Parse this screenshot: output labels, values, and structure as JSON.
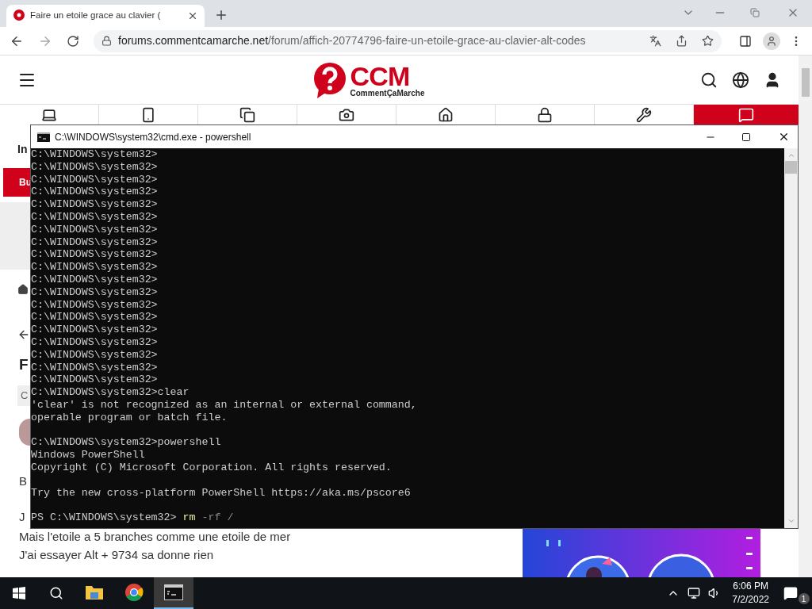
{
  "browser": {
    "tab": {
      "title": "Faire un etoile grace au clavier (",
      "selected": true
    },
    "url": {
      "host": "forums.commentcamarche.net",
      "path": "/forum/affich-20774796-faire-un-etoile-grace-au-clavier-alt-codes"
    }
  },
  "site": {
    "logo": {
      "mark": "CCM",
      "tagline": "CommentÇaMarche"
    },
    "fragments": [
      {
        "kind": "label",
        "text": "In"
      },
      {
        "kind": "button",
        "text": "Bu"
      },
      {
        "kind": "heading",
        "text": "F"
      },
      {
        "kind": "tag",
        "text": "C"
      },
      {
        "kind": "para",
        "text": "B"
      },
      {
        "kind": "para",
        "text": "J"
      }
    ],
    "post_lines": [
      "Mais l'etoile a 5 branches comme une etoile de mer",
      "J'ai essayer Alt + 9734 sa donne rien"
    ]
  },
  "console": {
    "title": "C:\\WINDOWS\\system32\\cmd.exe - powershell",
    "lines": [
      {
        "kind": "text",
        "text": "C:\\WINDOWS\\system32>"
      },
      {
        "kind": "text",
        "text": "C:\\WINDOWS\\system32>"
      },
      {
        "kind": "text",
        "text": "C:\\WINDOWS\\system32>"
      },
      {
        "kind": "text",
        "text": "C:\\WINDOWS\\system32>"
      },
      {
        "kind": "text",
        "text": "C:\\WINDOWS\\system32>"
      },
      {
        "kind": "text",
        "text": "C:\\WINDOWS\\system32>"
      },
      {
        "kind": "text",
        "text": "C:\\WINDOWS\\system32>"
      },
      {
        "kind": "text",
        "text": "C:\\WINDOWS\\system32>"
      },
      {
        "kind": "text",
        "text": "C:\\WINDOWS\\system32>"
      },
      {
        "kind": "text",
        "text": "C:\\WINDOWS\\system32>"
      },
      {
        "kind": "text",
        "text": "C:\\WINDOWS\\system32>"
      },
      {
        "kind": "text",
        "text": "C:\\WINDOWS\\system32>"
      },
      {
        "kind": "text",
        "text": "C:\\WINDOWS\\system32>"
      },
      {
        "kind": "text",
        "text": "C:\\WINDOWS\\system32>"
      },
      {
        "kind": "text",
        "text": "C:\\WINDOWS\\system32>"
      },
      {
        "kind": "text",
        "text": "C:\\WINDOWS\\system32>"
      },
      {
        "kind": "text",
        "text": "C:\\WINDOWS\\system32>"
      },
      {
        "kind": "text",
        "text": "C:\\WINDOWS\\system32>"
      },
      {
        "kind": "text",
        "text": "C:\\WINDOWS\\system32>"
      },
      {
        "kind": "text",
        "text": "C:\\WINDOWS\\system32>clear"
      },
      {
        "kind": "text",
        "text": "'clear' is not recognized as an internal or external command,"
      },
      {
        "kind": "text",
        "text": "operable program or batch file."
      },
      {
        "kind": "blank"
      },
      {
        "kind": "text",
        "text": "C:\\WINDOWS\\system32>powershell"
      },
      {
        "kind": "text",
        "text": "Windows PowerShell"
      },
      {
        "kind": "text",
        "text": "Copyright (C) Microsoft Corporation. All rights reserved."
      },
      {
        "kind": "blank"
      },
      {
        "kind": "text",
        "text": "Try the new cross-platform PowerShell https://aka.ms/pscore6"
      },
      {
        "kind": "blank"
      },
      {
        "kind": "input",
        "prompt": "PS C:\\WINDOWS\\system32>",
        "command": "rm",
        "args": "-rf /"
      }
    ]
  },
  "taskbar": {
    "apps": [
      {
        "kind": "folder",
        "selected": false
      },
      {
        "kind": "chrome",
        "selected": false
      },
      {
        "kind": "terminal",
        "selected": true
      }
    ],
    "time": "6:06 PM",
    "date": "7/2/2022",
    "notifications": "1"
  }
}
